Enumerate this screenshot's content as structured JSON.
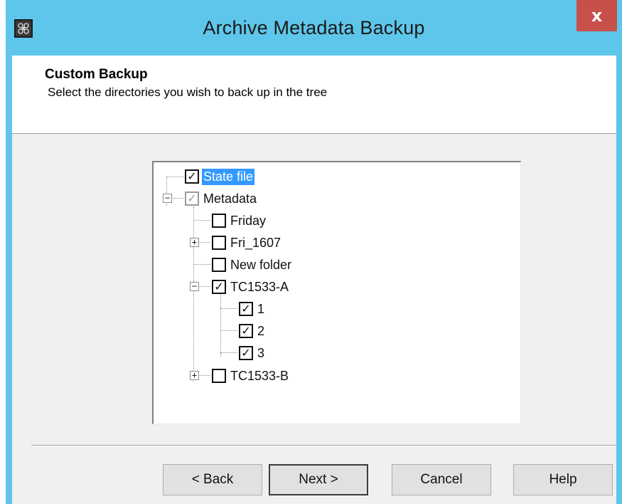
{
  "window": {
    "title": "Archive Metadata Backup",
    "app_icon": "archive-app-icon",
    "close_glyph": "x"
  },
  "header": {
    "title": "Custom Backup",
    "subtitle": "Select the directories you wish to back up in the tree"
  },
  "tree": {
    "items": [
      {
        "label": "State file",
        "checked": true,
        "selected": true
      },
      {
        "label": "Metadata",
        "checked": true,
        "disabled": true,
        "expanded": true
      },
      {
        "label": "Friday",
        "checked": false
      },
      {
        "label": "Fri_1607",
        "checked": false,
        "expandable": true
      },
      {
        "label": "New folder",
        "checked": false
      },
      {
        "label": "TC1533-A",
        "checked": true,
        "expanded": true
      },
      {
        "label": "1",
        "checked": true
      },
      {
        "label": "2",
        "checked": true
      },
      {
        "label": "3",
        "checked": true
      },
      {
        "label": "TC1533-B",
        "checked": false,
        "expandable": true
      }
    ],
    "check_glyph": "✓",
    "expand_glyph": "+",
    "collapse_glyph": "−"
  },
  "buttons": {
    "back": "< Back",
    "next": "Next >",
    "cancel": "Cancel",
    "help": "Help"
  },
  "colors": {
    "titlebar": "#5ec6ea",
    "close": "#c7504a",
    "selection": "#3399ff"
  }
}
